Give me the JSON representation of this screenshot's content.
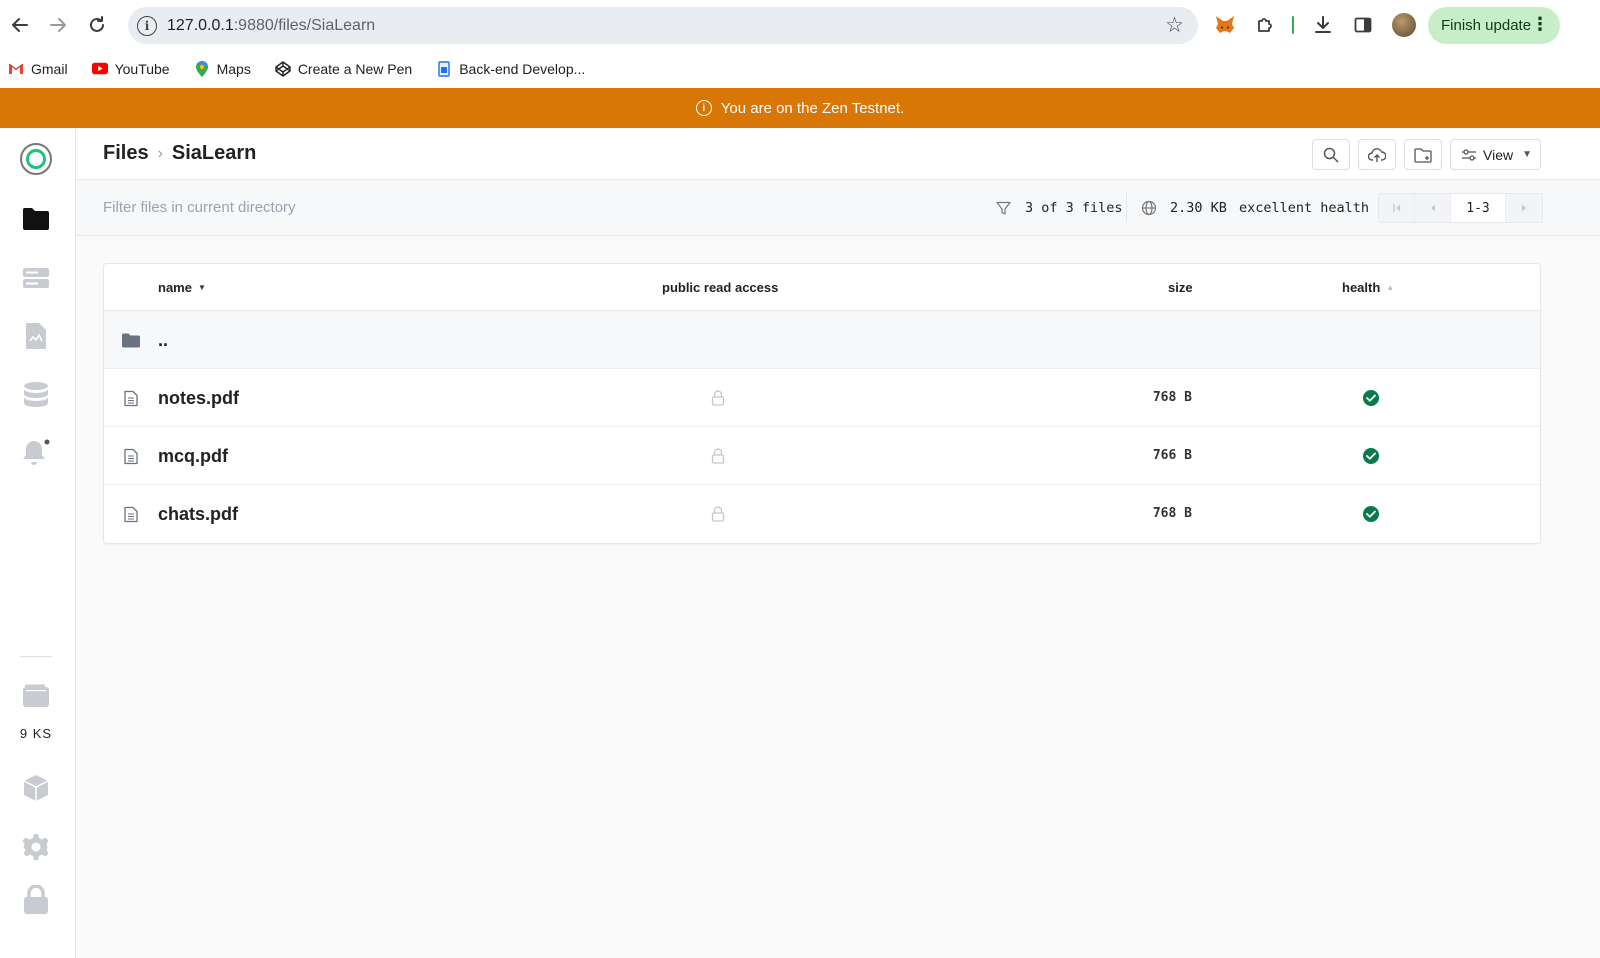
{
  "browser": {
    "url_host": "127.0.0.1",
    "url_path": ":9880/files/SiaLearn",
    "finish_update": "Finish update",
    "bookmarks": [
      {
        "label": "Gmail",
        "icon": "gmail-icon"
      },
      {
        "label": "YouTube",
        "icon": "youtube-icon"
      },
      {
        "label": "Maps",
        "icon": "maps-icon"
      },
      {
        "label": "Create a New Pen",
        "icon": "codepen-icon"
      },
      {
        "label": "Back-end Develop...",
        "icon": "bookmark-page-icon"
      }
    ]
  },
  "banner": {
    "text": "You are on the Zen Testnet."
  },
  "sidebar": {
    "balance": "9 KS",
    "items": [
      "files-icon",
      "hosts-icon",
      "contracts-icon",
      "database-icon",
      "notifications-icon",
      "wallet-icon",
      "cube-icon",
      "settings-icon",
      "lock-icon"
    ]
  },
  "header": {
    "crumb_root": "Files",
    "crumb_current": "SiaLearn",
    "view_label": "View"
  },
  "filter": {
    "placeholder": "Filter files in current directory",
    "count": "3 of 3 files",
    "size": "2.30 KB",
    "health": "excellent health",
    "page_range": "1-3"
  },
  "table": {
    "columns": {
      "name": "name",
      "public": "public read access",
      "size": "size",
      "health": "health"
    },
    "parent": "..",
    "rows": [
      {
        "name": "notes.pdf",
        "size": "768 B",
        "health": "good"
      },
      {
        "name": "mcq.pdf",
        "size": "766 B",
        "health": "good"
      },
      {
        "name": "chats.pdf",
        "size": "768 B",
        "health": "good"
      }
    ]
  },
  "colors": {
    "banner": "#d97706",
    "accent": "#1ec27a",
    "health_ok": "#087a4b"
  }
}
